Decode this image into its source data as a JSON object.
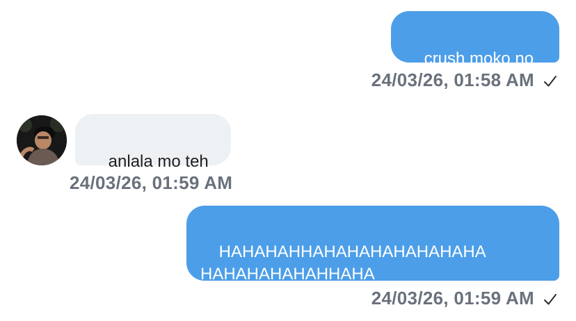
{
  "messages": [
    {
      "direction": "outgoing",
      "text": "crush moko no",
      "timestamp": "24/03/26, 01:58 AM",
      "read": true
    },
    {
      "direction": "incoming",
      "text": "anlala mo teh",
      "timestamp": "24/03/26, 01:59 AM",
      "avatar": "user-avatar"
    },
    {
      "direction": "outgoing",
      "text": "HAHAHAHHAHAHAHAHAHAHAHA\nHAHAHAHAHAHHAHA",
      "timestamp": "24/03/26, 01:59 AM",
      "read": true
    }
  ],
  "colors": {
    "outgoing_bubble": "#4c9ee8",
    "incoming_bubble": "#eef1f4",
    "timestamp_text": "#69717c"
  }
}
